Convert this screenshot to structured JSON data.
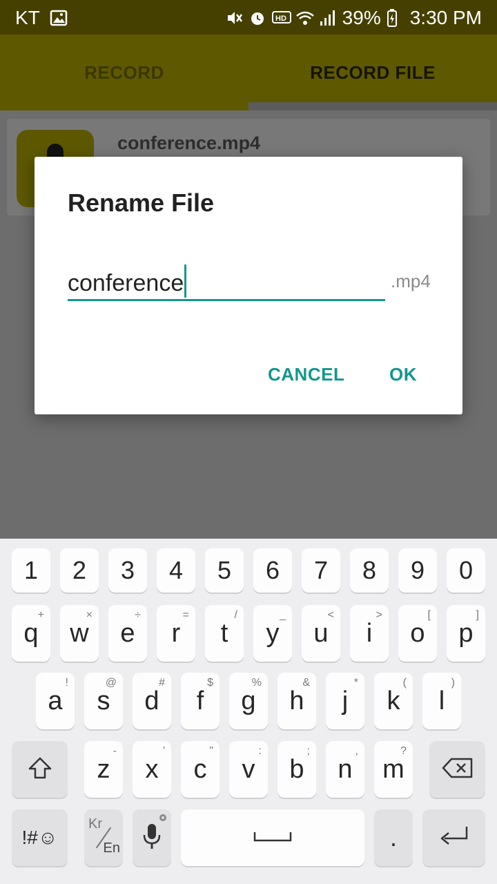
{
  "status_bar": {
    "carrier": "KT",
    "battery": "39%",
    "time": "3:30 PM"
  },
  "tabs": [
    {
      "label": "RECORD"
    },
    {
      "label": "RECORD FILE"
    }
  ],
  "file_list": [
    {
      "name": "conference.mp4"
    }
  ],
  "dialog": {
    "title": "Rename File",
    "input_value": "conference",
    "extension": ".mp4",
    "cancel_label": "CANCEL",
    "ok_label": "OK"
  },
  "keyboard": {
    "row_numbers": [
      "1",
      "2",
      "3",
      "4",
      "5",
      "6",
      "7",
      "8",
      "9",
      "0"
    ],
    "row_1": [
      {
        "key": "q",
        "sub": "+"
      },
      {
        "key": "w",
        "sub": "×"
      },
      {
        "key": "e",
        "sub": "÷"
      },
      {
        "key": "r",
        "sub": "="
      },
      {
        "key": "t",
        "sub": "/"
      },
      {
        "key": "y",
        "sub": "_"
      },
      {
        "key": "u",
        "sub": "<"
      },
      {
        "key": "i",
        "sub": ">"
      },
      {
        "key": "o",
        "sub": "["
      },
      {
        "key": "p",
        "sub": "]"
      }
    ],
    "row_2": [
      {
        "key": "a",
        "sub": "!"
      },
      {
        "key": "s",
        "sub": "@"
      },
      {
        "key": "d",
        "sub": "#"
      },
      {
        "key": "f",
        "sub": "$"
      },
      {
        "key": "g",
        "sub": "%"
      },
      {
        "key": "h",
        "sub": "&"
      },
      {
        "key": "j",
        "sub": "*"
      },
      {
        "key": "k",
        "sub": "("
      },
      {
        "key": "l",
        "sub": ")"
      }
    ],
    "row_3": [
      {
        "key": "z",
        "sub": "-"
      },
      {
        "key": "x",
        "sub": "'"
      },
      {
        "key": "c",
        "sub": "\""
      },
      {
        "key": "v",
        "sub": ":"
      },
      {
        "key": "b",
        "sub": ";"
      },
      {
        "key": "n",
        "sub": ","
      },
      {
        "key": "m",
        "sub": "?"
      }
    ],
    "symbols_label": "!#☺",
    "lang_label_top": "Kr",
    "lang_label_bottom": "En",
    "period_label": "."
  },
  "icons": {
    "gallery": "image-icon",
    "mute": "vibrate-mute-icon",
    "alarm": "alarm-icon",
    "hd": "hd-voice-icon",
    "wifi": "wifi-icon",
    "signal": "signal-icon",
    "battery": "battery-charging-icon",
    "shift": "shift-icon",
    "backspace": "backspace-icon",
    "mic": "microphone-icon",
    "enter": "enter-icon",
    "space": "space-icon"
  }
}
